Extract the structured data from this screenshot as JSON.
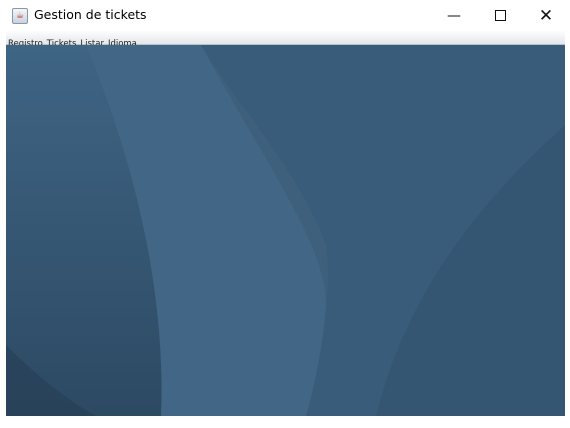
{
  "window": {
    "title": "Gestion de tickets",
    "icon": "java-icon",
    "controls": [
      "minimize-icon",
      "maximize-icon",
      "close-icon"
    ]
  },
  "menubar": {
    "items": [
      {
        "label": "Registro"
      },
      {
        "label": "Tickets",
        "mnemonic": "e"
      },
      {
        "label": "Listar"
      },
      {
        "label": "Idioma"
      }
    ]
  },
  "colors": {
    "desktop": "#3d5f7c"
  }
}
